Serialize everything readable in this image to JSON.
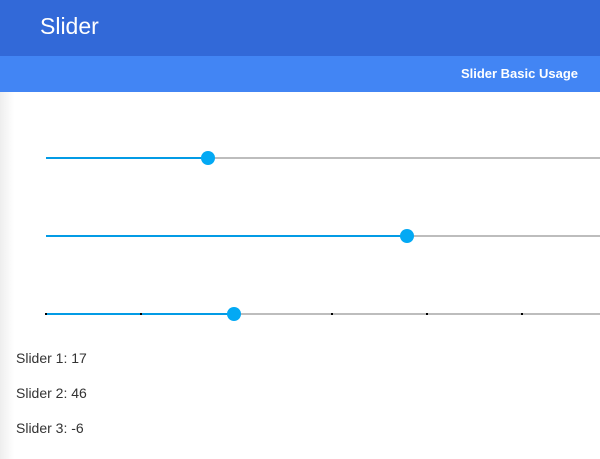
{
  "app_bar": {
    "title": "Slider"
  },
  "sub_bar": {
    "tab_label": "Slider Basic Usage"
  },
  "colors": {
    "app_bar": "#3269d8",
    "sub_bar": "#4285f4",
    "slider_accent": "#039be5",
    "slider_thumb": "#03a9f4",
    "slider_track": "#bdbdbd"
  },
  "sliders": [
    {
      "value": 17,
      "level_fraction": 0.29,
      "ticks": false
    },
    {
      "value": 46,
      "level_fraction": 0.645,
      "ticks": false
    },
    {
      "value": -6,
      "level_fraction": 0.335,
      "ticks": true,
      "tick_fractions": [
        0,
        0.17,
        0.34,
        0.51,
        0.68,
        0.85
      ]
    }
  ],
  "values": [
    {
      "text": "Slider 1: 17"
    },
    {
      "text": "Slider 2: 46"
    },
    {
      "text": "Slider 3: -6"
    }
  ]
}
